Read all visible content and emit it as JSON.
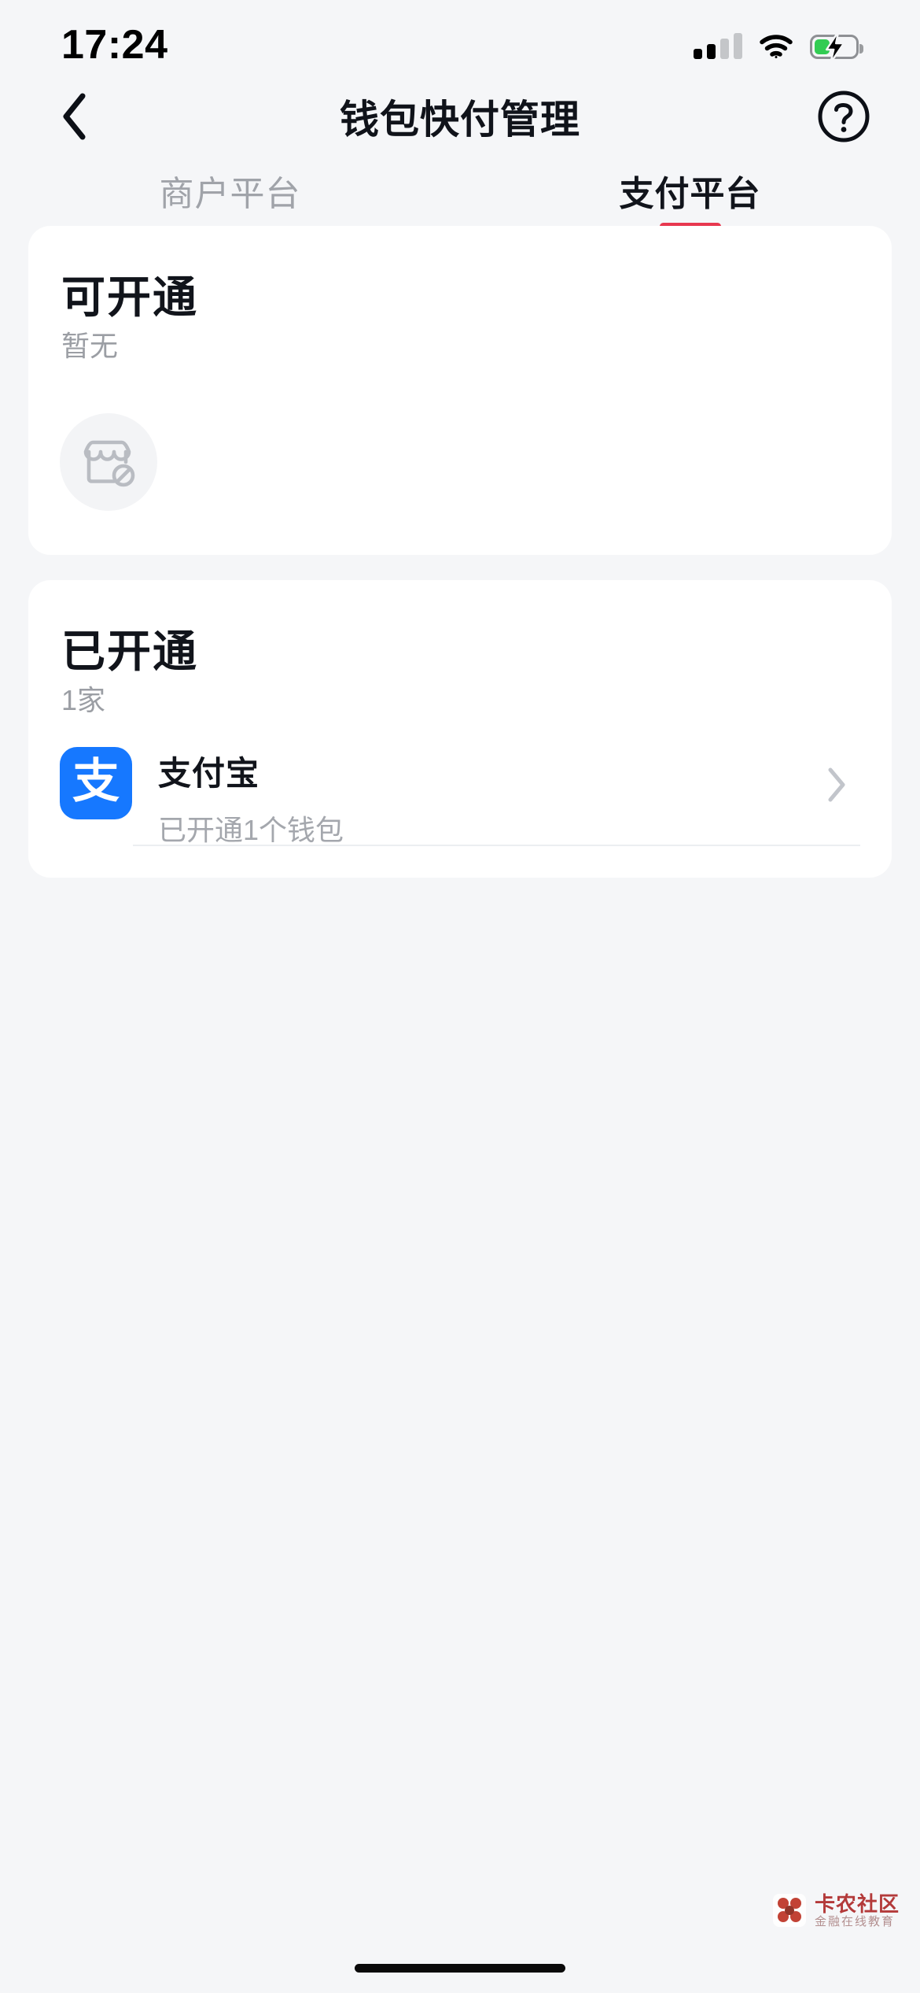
{
  "status_bar": {
    "time": "17:24",
    "signal_icon": "cellular-signal-icon",
    "wifi_icon": "wifi-icon",
    "battery_icon": "battery-charging-icon",
    "battery_level_percent": 38,
    "battery_fill_color": "#32cc53",
    "signal_active_bars": 2,
    "signal_total_bars": 4
  },
  "navbar": {
    "back_icon": "back-chevron-icon",
    "title": "钱包快付管理",
    "help_icon": "help-circle-icon"
  },
  "tabs": [
    {
      "label": "商户平台",
      "active": false
    },
    {
      "label": "支付平台",
      "active": true
    }
  ],
  "theme": {
    "accent": "#e8384f",
    "page_background": "#f5f6f8",
    "card_background": "#ffffff",
    "text_primary": "#11141b",
    "text_secondary": "#9b9ea4",
    "alipay_blue": "#1678ff"
  },
  "cards": {
    "available": {
      "title": "可开通",
      "subtitle": "暂无",
      "empty_icon": "store-disabled-icon"
    },
    "enabled": {
      "title": "已开通",
      "subtitle": "1家",
      "items": [
        {
          "logo_glyph": "支",
          "logo_name": "alipay-logo-icon",
          "name": "支付宝",
          "desc": "已开通1个钱包",
          "chevron_icon": "chevron-right-icon"
        }
      ]
    }
  },
  "watermark": {
    "title": "卡农社区",
    "subtitle": "金融在线教育",
    "icon": "kanong-logo-icon"
  },
  "home_indicator": "home-indicator-bar"
}
